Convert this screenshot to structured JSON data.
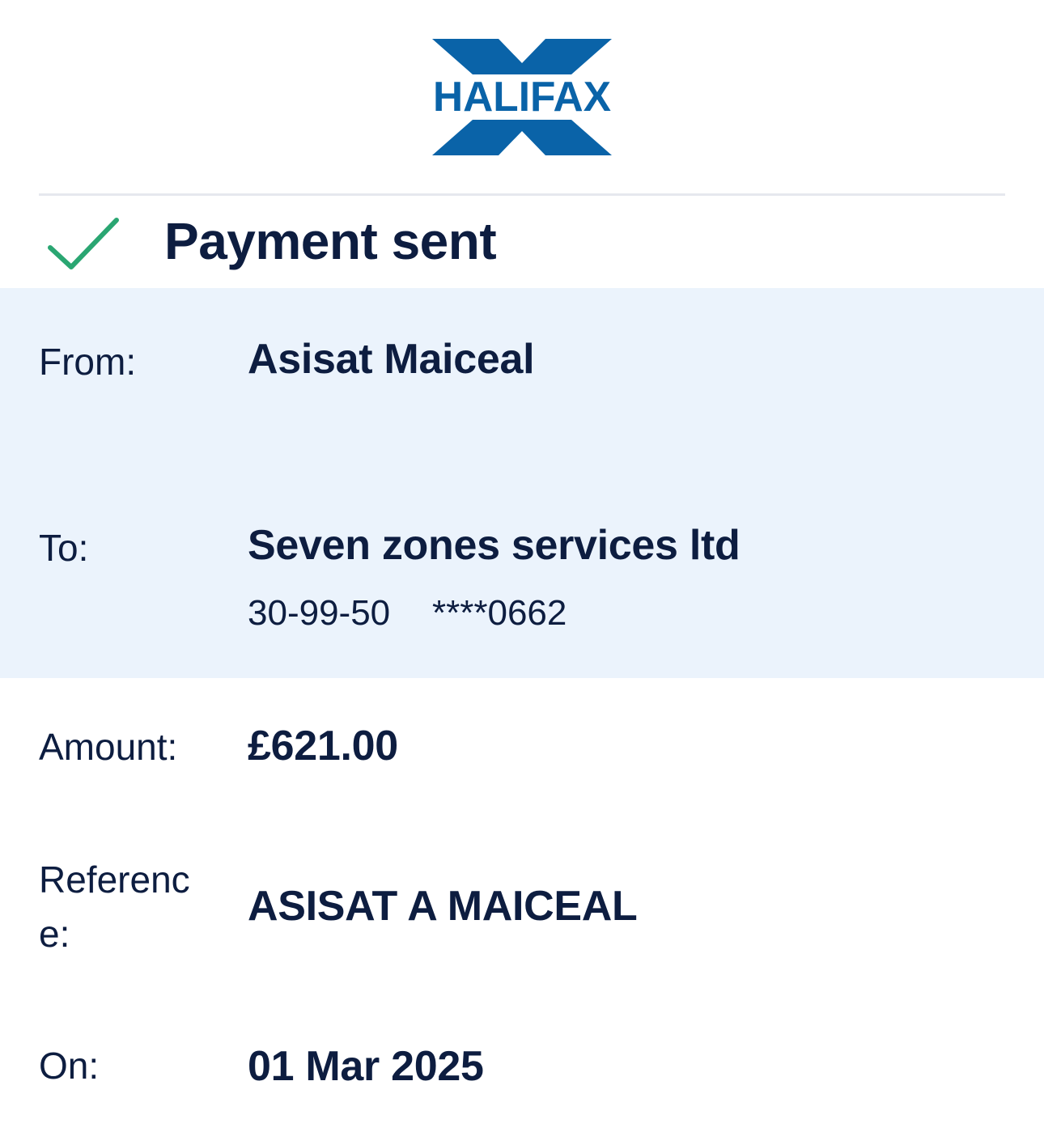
{
  "brand": {
    "name": "HALIFAX",
    "color": "#0a63a8"
  },
  "status": {
    "title": "Payment sent",
    "icon": "check-icon",
    "icon_color": "#2aa672"
  },
  "from": {
    "label": "From:",
    "value": "Asisat Maiceal"
  },
  "to": {
    "label": "To:",
    "value": "Seven zones services ltd",
    "sort_code": "30-99-50",
    "account_number": "****0662"
  },
  "amount": {
    "label": "Amount:",
    "value": "£621.00"
  },
  "reference": {
    "label": "Reference:",
    "value": "ASISAT A MAICEAL"
  },
  "date": {
    "label": "On:",
    "value": "01 Mar 2025"
  },
  "colors": {
    "text": "#0d1d40",
    "highlight_background": "#ebf3fc",
    "divider": "#e6e8ee"
  }
}
